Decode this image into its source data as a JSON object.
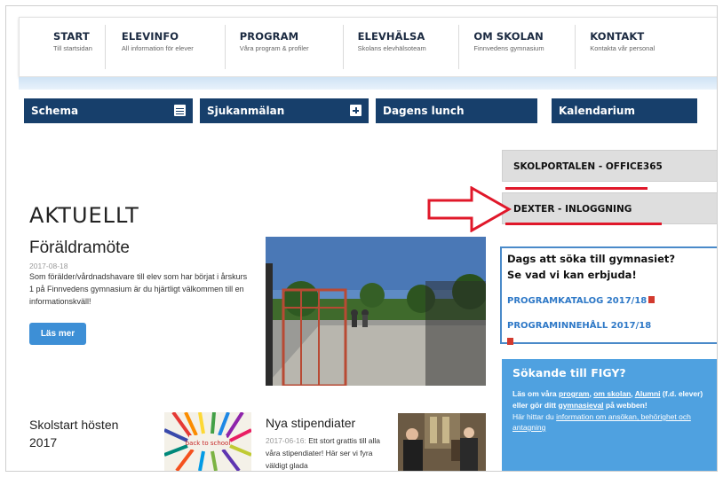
{
  "nav": [
    {
      "title": "START",
      "subtitle": "Till startsidan"
    },
    {
      "title": "ELEVINFO",
      "subtitle": "All information för elever"
    },
    {
      "title": "PROGRAM",
      "subtitle": "Våra program & profiler"
    },
    {
      "title": "ELEVHÄLSA",
      "subtitle": "Skolans elevhälsoteam"
    },
    {
      "title": "OM SKOLAN",
      "subtitle": "Finnvedens gymnasium"
    },
    {
      "title": "KONTAKT",
      "subtitle": "Kontakta vår personal"
    }
  ],
  "toolbar": {
    "schema": "Schema",
    "sjukanmalan": "Sjukanmälan",
    "lunch": "Dagens lunch",
    "kalendarium": "Kalendarium"
  },
  "side": {
    "skolportalen": "SKOLPORTALEN - OFFICE365",
    "dexter": "DEXTER - INLOGGNING"
  },
  "news": {
    "section": "AKTUELLT",
    "title": "Föräldramöte",
    "date": "2017-08-18",
    "body": "Som förälder/vårdnadshavare till elev som har börjat i årskurs 1 på Finnvedens gymnasium är du hjärtligt välkommen till en informationskväll!",
    "button": "Läs mer"
  },
  "program_box": {
    "q1": "Dags att söka till gymnasiet?",
    "q2": "Se vad vi kan erbjuda!",
    "link1": "PROGRAMKATALOG 2017/18",
    "link2": "PROGRAMINNEHÅLL 2017/18"
  },
  "figy": {
    "heading": "Sökande till FIGY?",
    "t1": "Läs om våra",
    "l1": "program",
    "t2": ",",
    "l2": "om skolan",
    "t3": ",",
    "l3": "Alumni",
    "t4": "(f.d. elever) eller gör ditt",
    "l4": "gymnasieval",
    "t5": "på webben!",
    "t6": "Här hittar du",
    "l5": "information om ansökan, behörighet och antagning"
  },
  "lower": {
    "skolstart": "Skolstart hösten 2017",
    "nya_title": "Nya stipendiater",
    "nya_date": "2017-06-16:",
    "nya_body": "Ett stort grattis till alla våra stipendiater! Här ser vi fyra väldigt glada"
  },
  "thumb_text": "back to school",
  "colors": {
    "toolbar_bg": "#173f6b",
    "accent_red": "#e0182a",
    "figy_bg": "#4fa1e0",
    "link_blue": "#2f79c7"
  }
}
